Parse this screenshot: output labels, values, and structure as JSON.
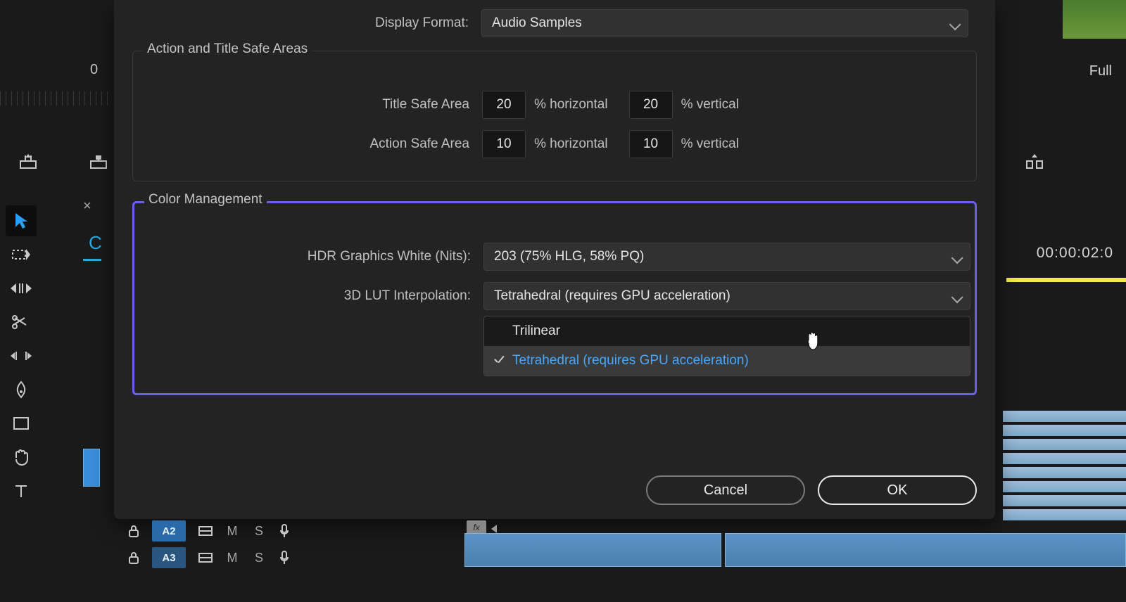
{
  "background": {
    "zero": "0",
    "timecode": "00:00:02:0",
    "full_label": "Full",
    "cyan_letter": "C"
  },
  "dialog": {
    "display_format": {
      "label": "Display Format:",
      "value": "Audio Samples"
    },
    "safe_areas": {
      "legend": "Action and Title Safe Areas",
      "title_label": "Title Safe Area",
      "action_label": "Action Safe Area",
      "title_h": "20",
      "title_v": "20",
      "action_h": "10",
      "action_v": "10",
      "pct_h": "% horizontal",
      "pct_v": "% vertical"
    },
    "color_mgmt": {
      "legend": "Color Management",
      "hdr_label": "HDR Graphics White (Nits):",
      "hdr_value": "203 (75% HLG, 58% PQ)",
      "lut_label": "3D LUT Interpolation:",
      "lut_value": "Tetrahedral (requires GPU acceleration)",
      "options": {
        "trilinear": "Trilinear",
        "tetrahedral": "Tetrahedral (requires GPU acceleration)"
      }
    },
    "buttons": {
      "cancel": "Cancel",
      "ok": "OK"
    }
  },
  "tracks": {
    "a2": "A2",
    "a3": "A3",
    "m": "M",
    "s": "S",
    "fx": "fx"
  }
}
